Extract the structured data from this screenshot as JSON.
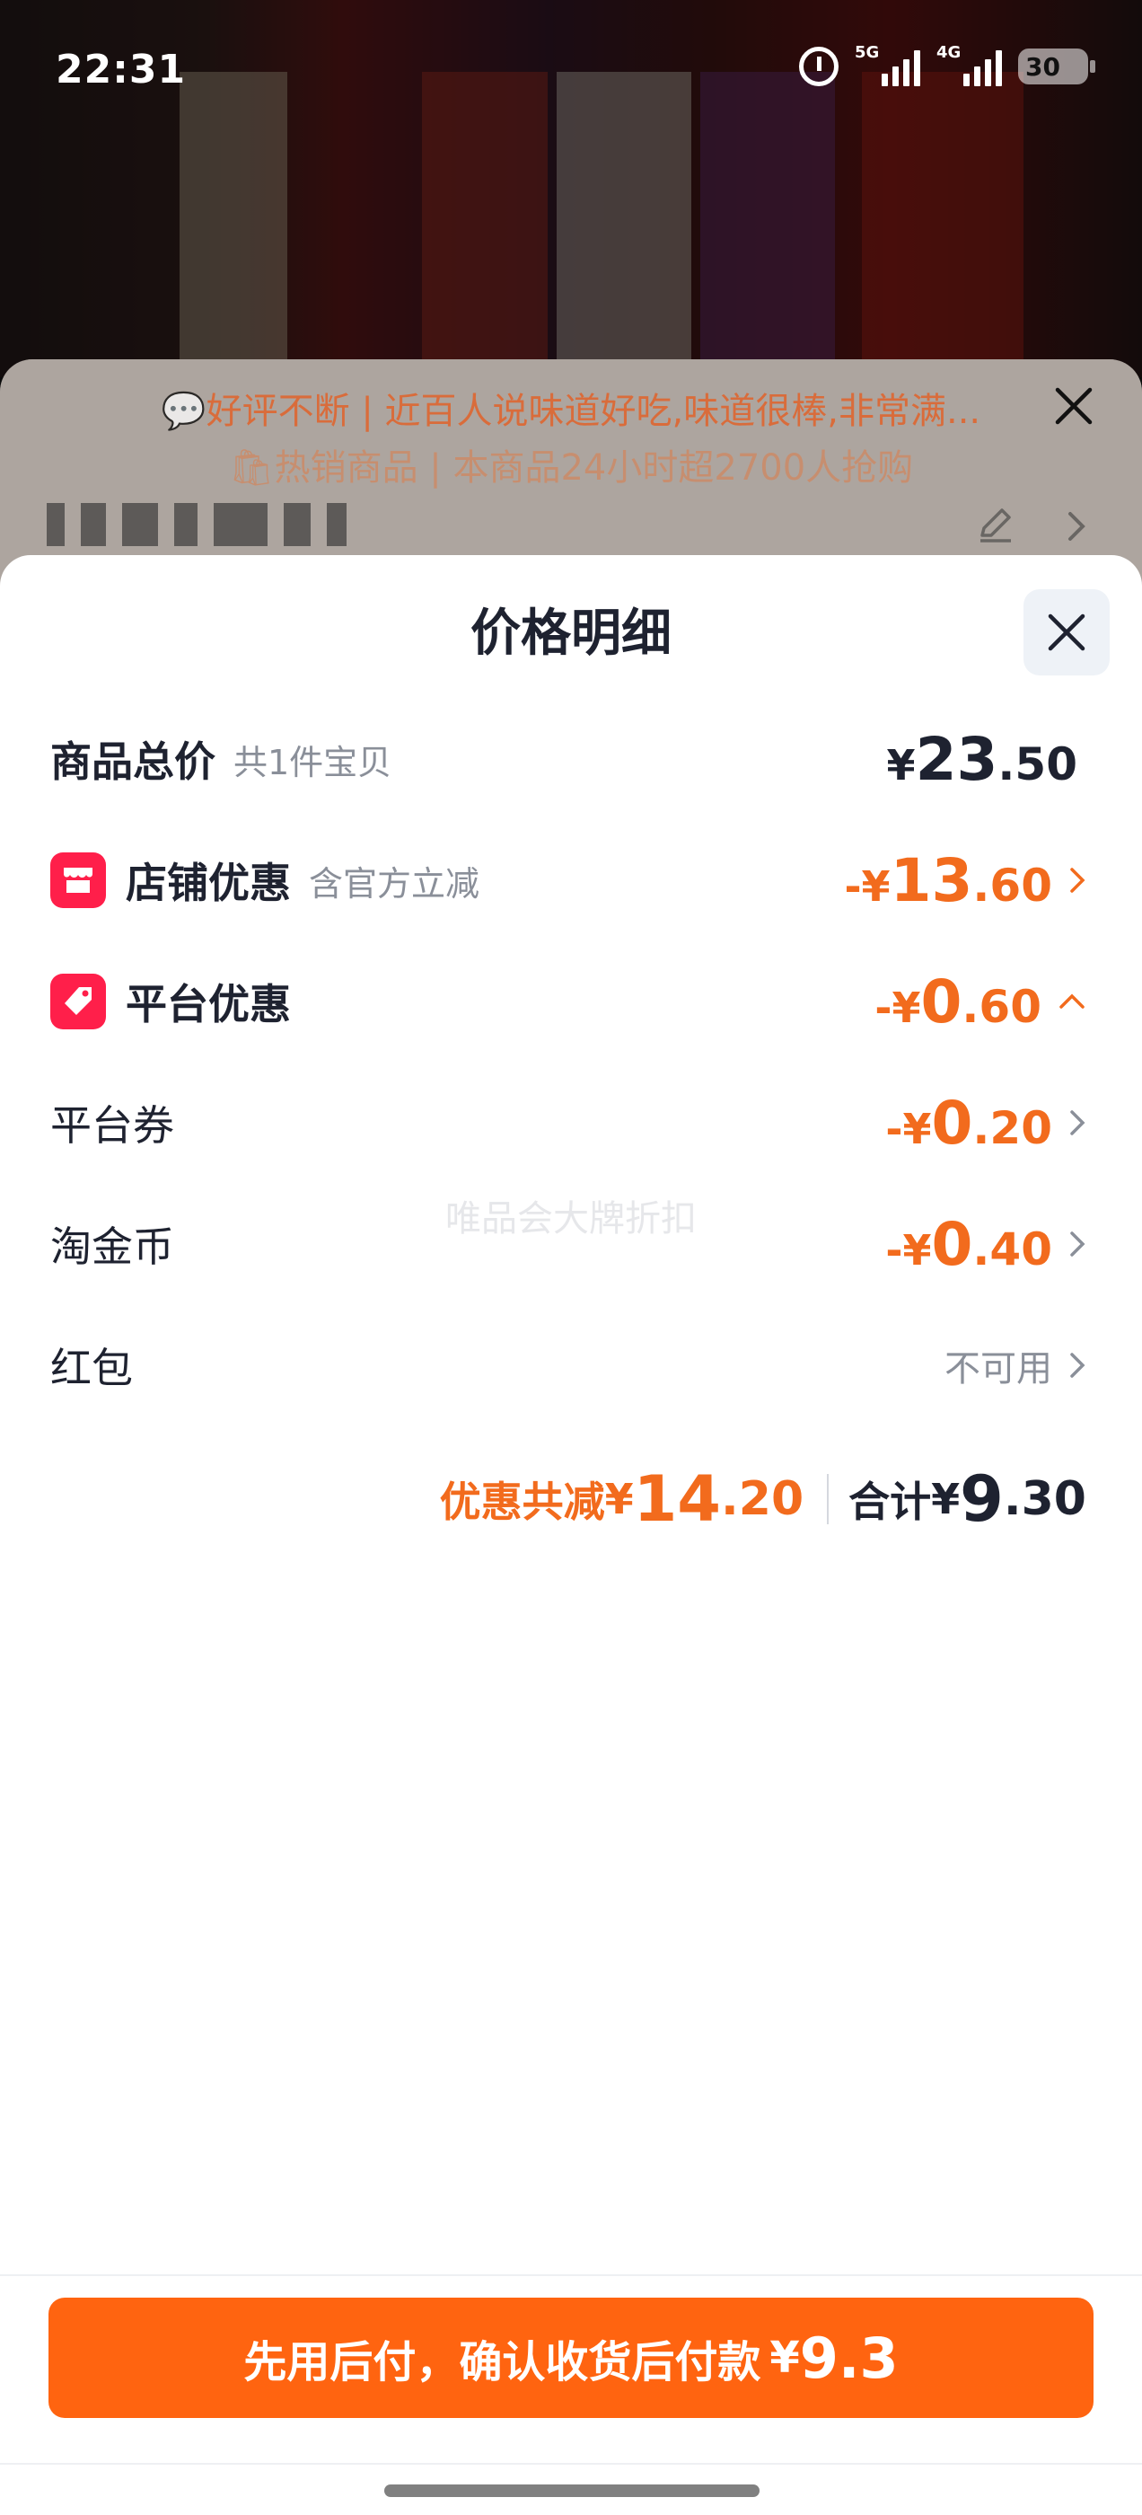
{
  "status_bar": {
    "time": "22:31",
    "net1": "5G",
    "net2": "4G",
    "battery": "30"
  },
  "background": {
    "promo_line1": "💬好评不断 | 近百人说味道好吃,味道很棒,非常满...",
    "promo_line2": "🛍热销商品 | 本商品24小时超2700人抢购"
  },
  "sheet": {
    "title": "价格明细",
    "rows": {
      "total": {
        "label": "商品总价",
        "sub": "共1件宝贝",
        "currency": "¥",
        "int": "23",
        "dec": ".50"
      },
      "shop": {
        "label": "店铺优惠",
        "sub": "含官方立减",
        "currency": "-¥",
        "int": "13",
        "dec": ".60"
      },
      "platform": {
        "label": "平台优惠",
        "currency": "-¥",
        "int": "0",
        "dec": ".60"
      },
      "coupon": {
        "label": "平台券",
        "currency": "-¥",
        "int": "0",
        "dec": ".20"
      },
      "coins": {
        "label": "淘金币",
        "currency": "-¥",
        "int": "0",
        "dec": ".40"
      },
      "redpacket": {
        "label": "红包",
        "status": "不可用"
      }
    },
    "watermark": "唯品会大牌折扣",
    "summary": {
      "discount_label": "优惠共减",
      "discount_currency": "¥",
      "discount_int": "14",
      "discount_dec": ".20",
      "total_label": "合计",
      "total_currency": "¥",
      "total_int": "9",
      "total_dec": ".30"
    },
    "pay_button": {
      "text": "先用后付，确认收货后付款",
      "currency": "¥",
      "value": "9.3"
    }
  },
  "colors": {
    "accent": "#ff6410",
    "discount": "#f26b1d",
    "badge": "#ff1f4a",
    "text": "#1e2230",
    "muted": "#8a8f99"
  }
}
